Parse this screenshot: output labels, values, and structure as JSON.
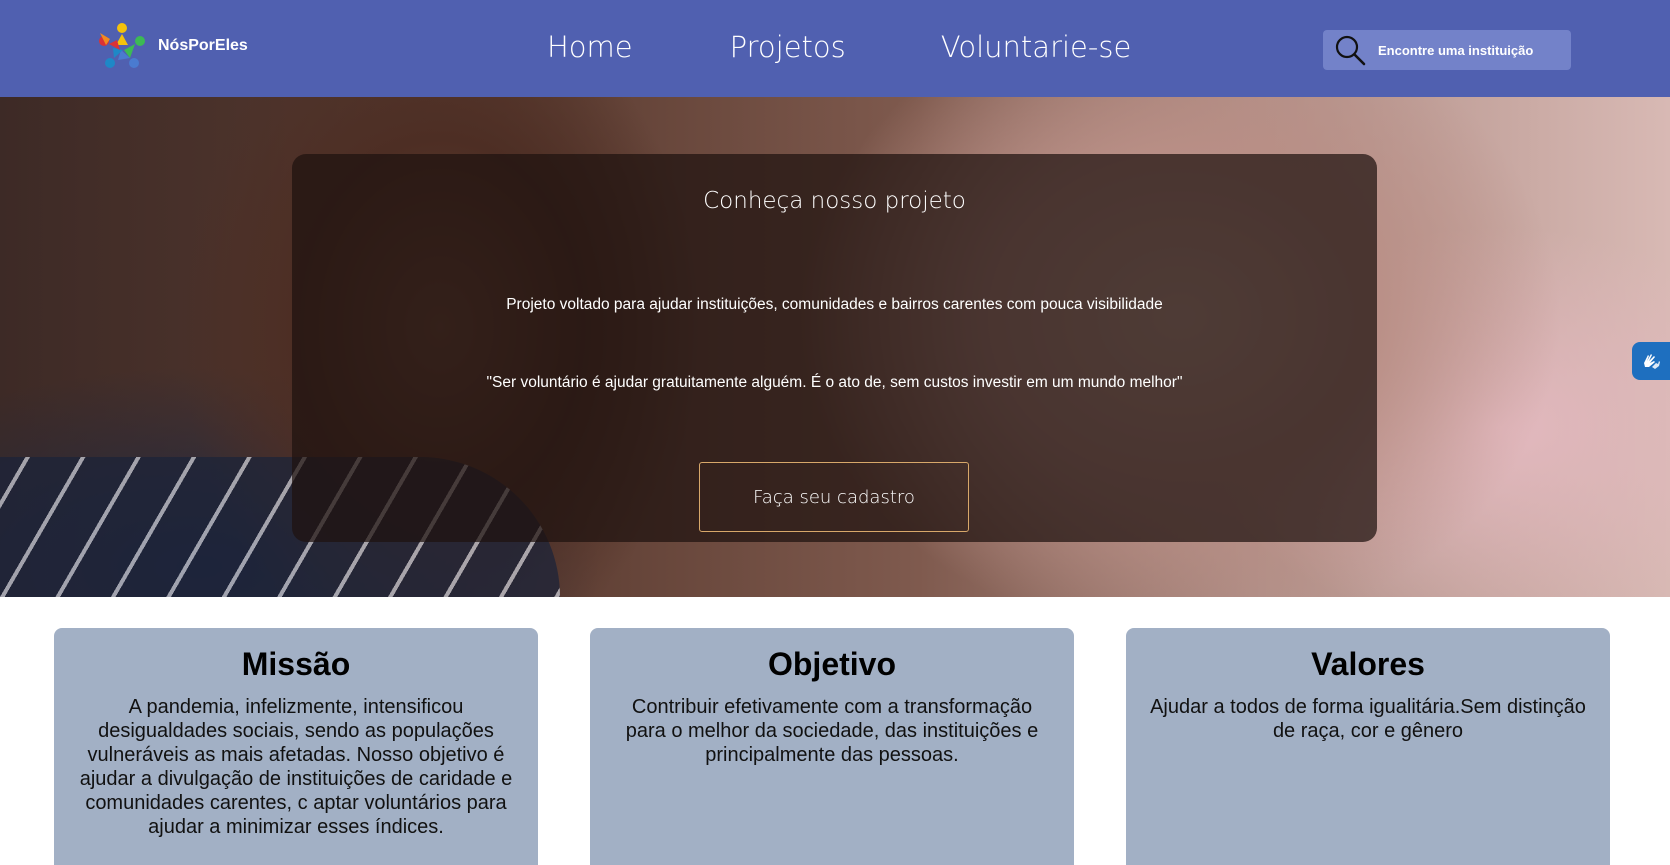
{
  "header": {
    "brand_name": "NósPorEles",
    "nav": {
      "home": "Home",
      "projetos": "Projetos",
      "voluntarie": "Voluntarie-se"
    },
    "search": {
      "placeholder": "Encontre uma instituição"
    },
    "colors": {
      "background": "#5060b0",
      "search_bg": "#7382c9"
    }
  },
  "hero": {
    "title": "Conheça nosso projeto",
    "description": "Projeto voltado para ajudar instituições, comunidades e bairros carentes com pouca visibilidade",
    "quote": "\"Ser voluntário é ajudar gratuitamente alguém. É o ato de, sem custos investir em um mundo melhor\"",
    "cta_label": "Faça seu cadastro",
    "colors": {
      "cta_border": "#d8a86a"
    }
  },
  "accessibility_widget": {
    "icon": "hands-sign-language-icon"
  },
  "cards": [
    {
      "title": "Missão",
      "text": "A pandemia, infelizmente, intensificou desigualdades sociais, sendo as populações vulneráveis as mais afetadas. Nosso objetivo é ajudar a divulgação de instituições de caridade e comunidades carentes, c aptar voluntários para ajudar a minimizar esses índices."
    },
    {
      "title": "Objetivo",
      "text": "Contribuir efetivamente com a transformação para o melhor da sociedade, das instituições e principalmente das pessoas."
    },
    {
      "title": "Valores",
      "text": "Ajudar a todos de forma igualitária.Sem distinção de raça, cor e gênero"
    }
  ]
}
